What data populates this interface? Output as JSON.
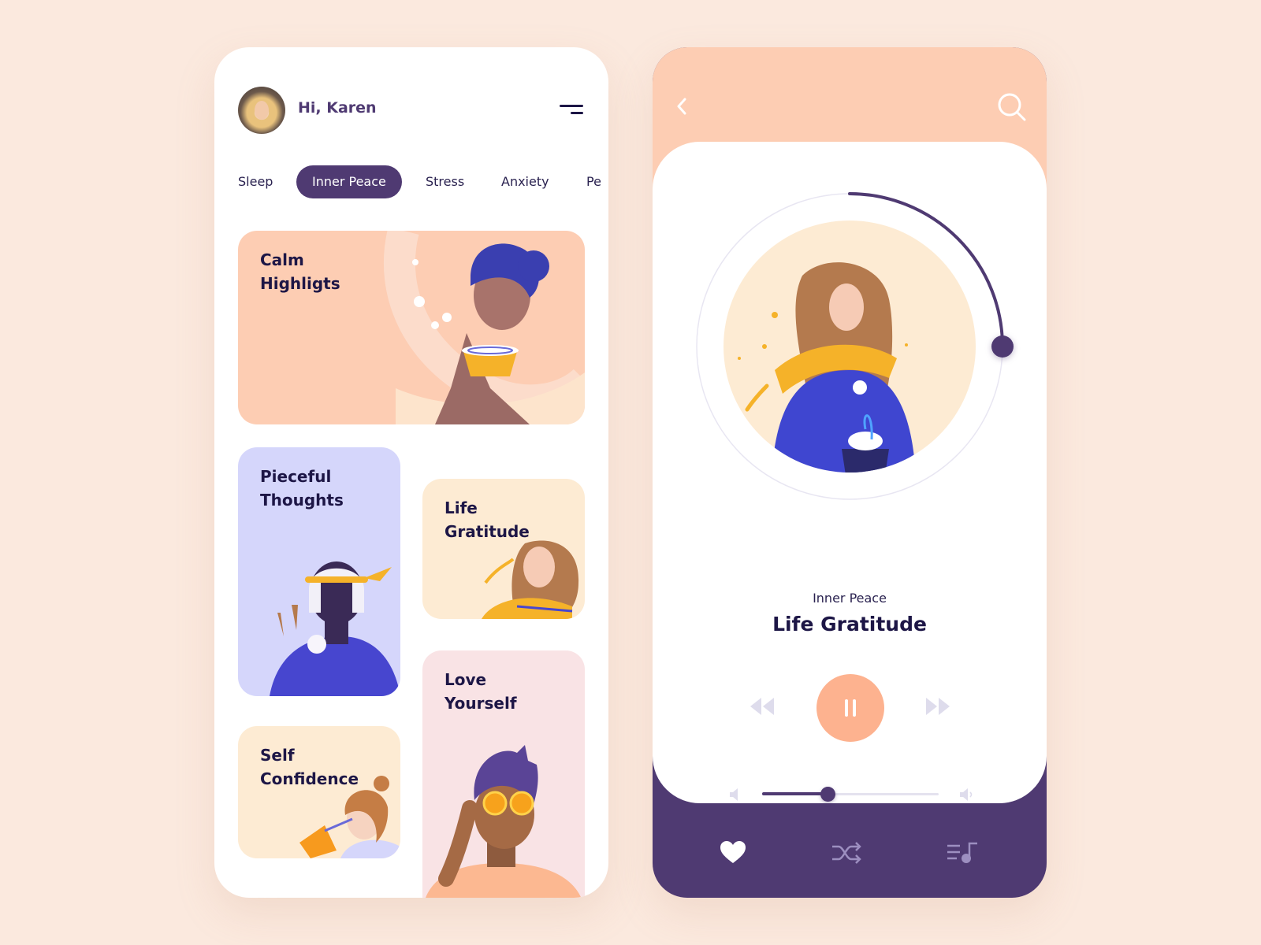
{
  "home": {
    "greeting": "Hi, Karen",
    "avatar_alt": "Karen profile photo",
    "menu_icon": "menu-icon",
    "categories": [
      {
        "label": "Sleep",
        "active": false
      },
      {
        "label": "Inner Peace",
        "active": true
      },
      {
        "label": "Stress",
        "active": false
      },
      {
        "label": "Anxiety",
        "active": false
      },
      {
        "label": "Pe",
        "active": false
      }
    ],
    "cards": {
      "calm": {
        "title": "Calm\nHighligts",
        "color": "#fdcdb3"
      },
      "pieceful": {
        "title": "Pieceful\nThoughts",
        "color": "#d5d6fb"
      },
      "life": {
        "title": "Life\nGratitude",
        "color": "#fdebd3"
      },
      "self": {
        "title": "Self\nConfidence",
        "color": "#fdebd3"
      },
      "love": {
        "title": "Love\nYourself",
        "color": "#f9e3e5"
      }
    }
  },
  "player": {
    "back_icon": "chevron-left-icon",
    "search_icon": "search-icon",
    "category": "Inner Peace",
    "title": "Life Gratitude",
    "playback_progress": 0.25,
    "state": "playing",
    "controls": {
      "rewind_icon": "rewind-icon",
      "pause_icon": "pause-icon",
      "forward_icon": "fast-forward-icon"
    },
    "volume": 0.37,
    "nav": [
      {
        "name": "favorites",
        "icon": "heart-icon",
        "active": true
      },
      {
        "name": "shuffle",
        "icon": "shuffle-icon",
        "active": false
      },
      {
        "name": "playlist",
        "icon": "playlist-icon",
        "active": false
      }
    ]
  },
  "colors": {
    "background": "#fbe9de",
    "accent_purple": "#4f3a72",
    "peach": "#fdcdb3",
    "pause_button": "#fdb28f",
    "text_dark": "#1d1646"
  }
}
